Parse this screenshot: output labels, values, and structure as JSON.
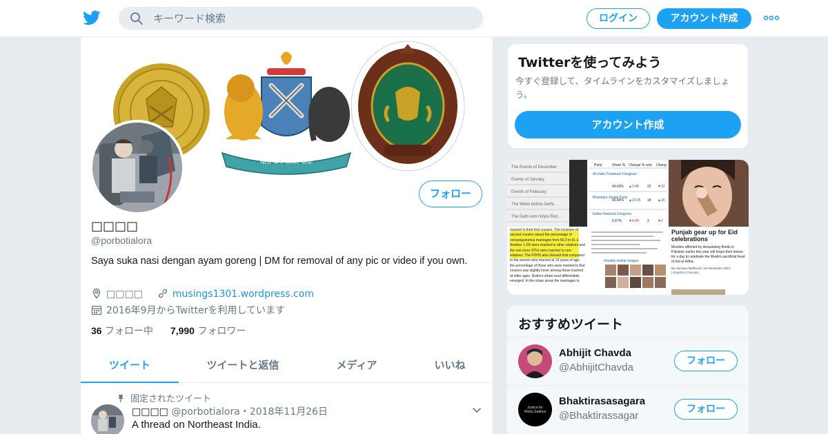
{
  "colors": {
    "brand": "#1da1f2",
    "link": "#1b95e0",
    "muted": "#657786",
    "text": "#14171a",
    "background": "#e6ecf0"
  },
  "header": {
    "search_placeholder": "キーワード検索",
    "login_label": "ログイン",
    "signup_label": "アカウント作成",
    "icons": [
      "twitter-bird-icon",
      "search-icon",
      "more-dots-icon"
    ]
  },
  "profile": {
    "name": "□□□□",
    "handle": "@porbotialora",
    "bio": "Saya suka nasi dengan ayam goreng | DM for removal of any pic or video if you own.",
    "location": "□□□□",
    "website": "musings1301.wordpress.com",
    "joined": "2016年9月からTwitterを利用しています",
    "following_count": "36",
    "following_label": "フォロー中",
    "followers_count": "7,990",
    "followers_label": "フォロワー",
    "follow_label": "フォロー",
    "banner_motto": "यतो धर्म स्ततो जयः"
  },
  "tabs": [
    {
      "label": "ツイート",
      "active": true
    },
    {
      "label": "ツイートと返信",
      "active": false
    },
    {
      "label": "メディア",
      "active": false
    },
    {
      "label": "いいね",
      "active": false
    }
  ],
  "pinned_tweet": {
    "pinned_label": "固定されたツイート",
    "name": "□□□□",
    "handle": "@porbotialora",
    "date": "・2018年11月26日",
    "text": "A thread on Northeast India."
  },
  "sidebar": {
    "try_title": "Twitterを使ってみよう",
    "try_desc": "今すぐ登録して、タイムラインをカスタマイズしましょう。",
    "try_button": "アカウント作成",
    "media_thumbs": {
      "menu_items": [
        "The Events of December",
        "Events of January",
        "Events of February",
        "The Week before Delhi...",
        "The Delhi Anti Hindu Riot..."
      ],
      "table_headers": [
        "Party",
        "Share %",
        "Change %",
        "won",
        "Chang"
      ],
      "table_rows": [
        [
          "All India Trinamool Congress",
          "43.69%",
          "▲3.48",
          "22",
          "▼12"
        ],
        [
          "Bharatiya Janata Party",
          "40.64%",
          "▲22.25",
          "18",
          "▲16"
        ],
        [
          "Indian National Congress",
          "5.67%",
          "▼4.09",
          "2",
          "▼2"
        ]
      ],
      "article_text": "married to their first cousins. The inclusion of second cousins raised the percentage of consanguineous marriages from 50.3 to 61.2. Another 1.3% were married to other relatives and the rest (over 37%) were married to non-relatives. The PDHS also showed that compared to the women who married at 10 years of age, the percentage of those who were married to first cousins was slightly lower among those married at older ages. Distinct urban-rural differentials emerged. In the urban areas the marriages to",
      "visually_similar": "Visually similar images",
      "news_title": "Punjab gear up for Eid celebrations",
      "news_body": "Muslims affected by devastating floods in Pakistan earlier this year will forget their losses for a day to celebrate the Muslim sacrificial feast of Eid al-Adha.",
      "news_byline": "By Humaira Mehboob | 16 November 2010",
      "news_langs": "| Español | Français"
    },
    "rec_title": "おすすめツイート",
    "recommendations": [
      {
        "name": "Abhijit Chavda",
        "handle": "@AbhijitChavda",
        "follow": "フォロー"
      },
      {
        "name": "Bhaktirasasagara",
        "handle": "@Bhaktirassagar",
        "follow": "フォロー",
        "avatar_text": "Justice for Hindu Sadhus"
      }
    ]
  }
}
